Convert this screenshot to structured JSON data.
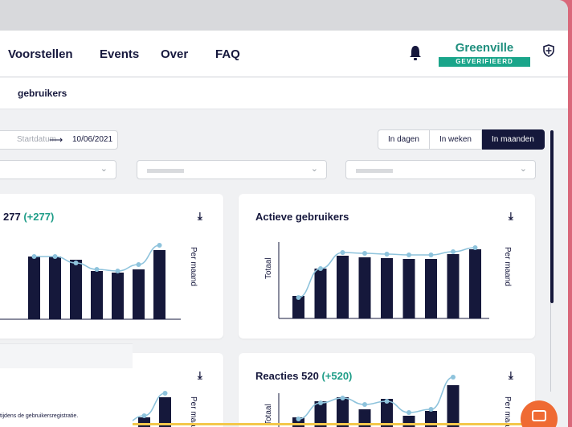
{
  "nav": {
    "links": [
      "Voorstellen",
      "Events",
      "Over",
      "FAQ"
    ],
    "org_name": "Greenville",
    "org_badge": "GEVERIFIEERD"
  },
  "breadcrumb": "gebruikers",
  "filters": {
    "date_from_placeholder": "Startdatum",
    "arrow": "⟶",
    "date_to": "10/06/2021",
    "segments": [
      "In dagen",
      "In weken",
      "In maanden"
    ],
    "active_segment": "In maanden"
  },
  "cards": [
    {
      "title_value": "277",
      "title_delta": "(+277)",
      "side_label": "Per maand",
      "chart": {
        "values": [
          78,
          78,
          74,
          60,
          58,
          62,
          86
        ],
        "line": [
          78,
          78,
          70,
          62,
          60,
          68,
          92
        ]
      }
    },
    {
      "title": "Actieve gebruikers",
      "side_label": "Per maand",
      "y_label": "Totaal",
      "chart": {
        "values": [
          28,
          62,
          78,
          76,
          75,
          74,
          74,
          80,
          86
        ],
        "line": [
          26,
          62,
          82,
          81,
          80,
          79,
          79,
          83,
          88
        ]
      }
    },
    {
      "side_label": "Per maand",
      "chart": {
        "values": [
          8,
          12,
          20,
          45
        ],
        "line": [
          8,
          12,
          22,
          50
        ]
      }
    },
    {
      "title_prefix": "Reacties",
      "title_value": "520",
      "title_delta": "(+520)",
      "side_label": "Per maand",
      "y_label": "Totaal",
      "chart": {
        "values": [
          20,
          40,
          45,
          30,
          43,
          22,
          28,
          60
        ],
        "line": [
          18,
          38,
          44,
          36,
          40,
          26,
          30,
          70
        ]
      }
    }
  ],
  "toast_message": "tijdens de gebruikersregistratie.",
  "colors": {
    "bar": "#15183b",
    "line": "#8ec3dc",
    "accent": "#1aa58a",
    "chat": "#ef6a33"
  }
}
